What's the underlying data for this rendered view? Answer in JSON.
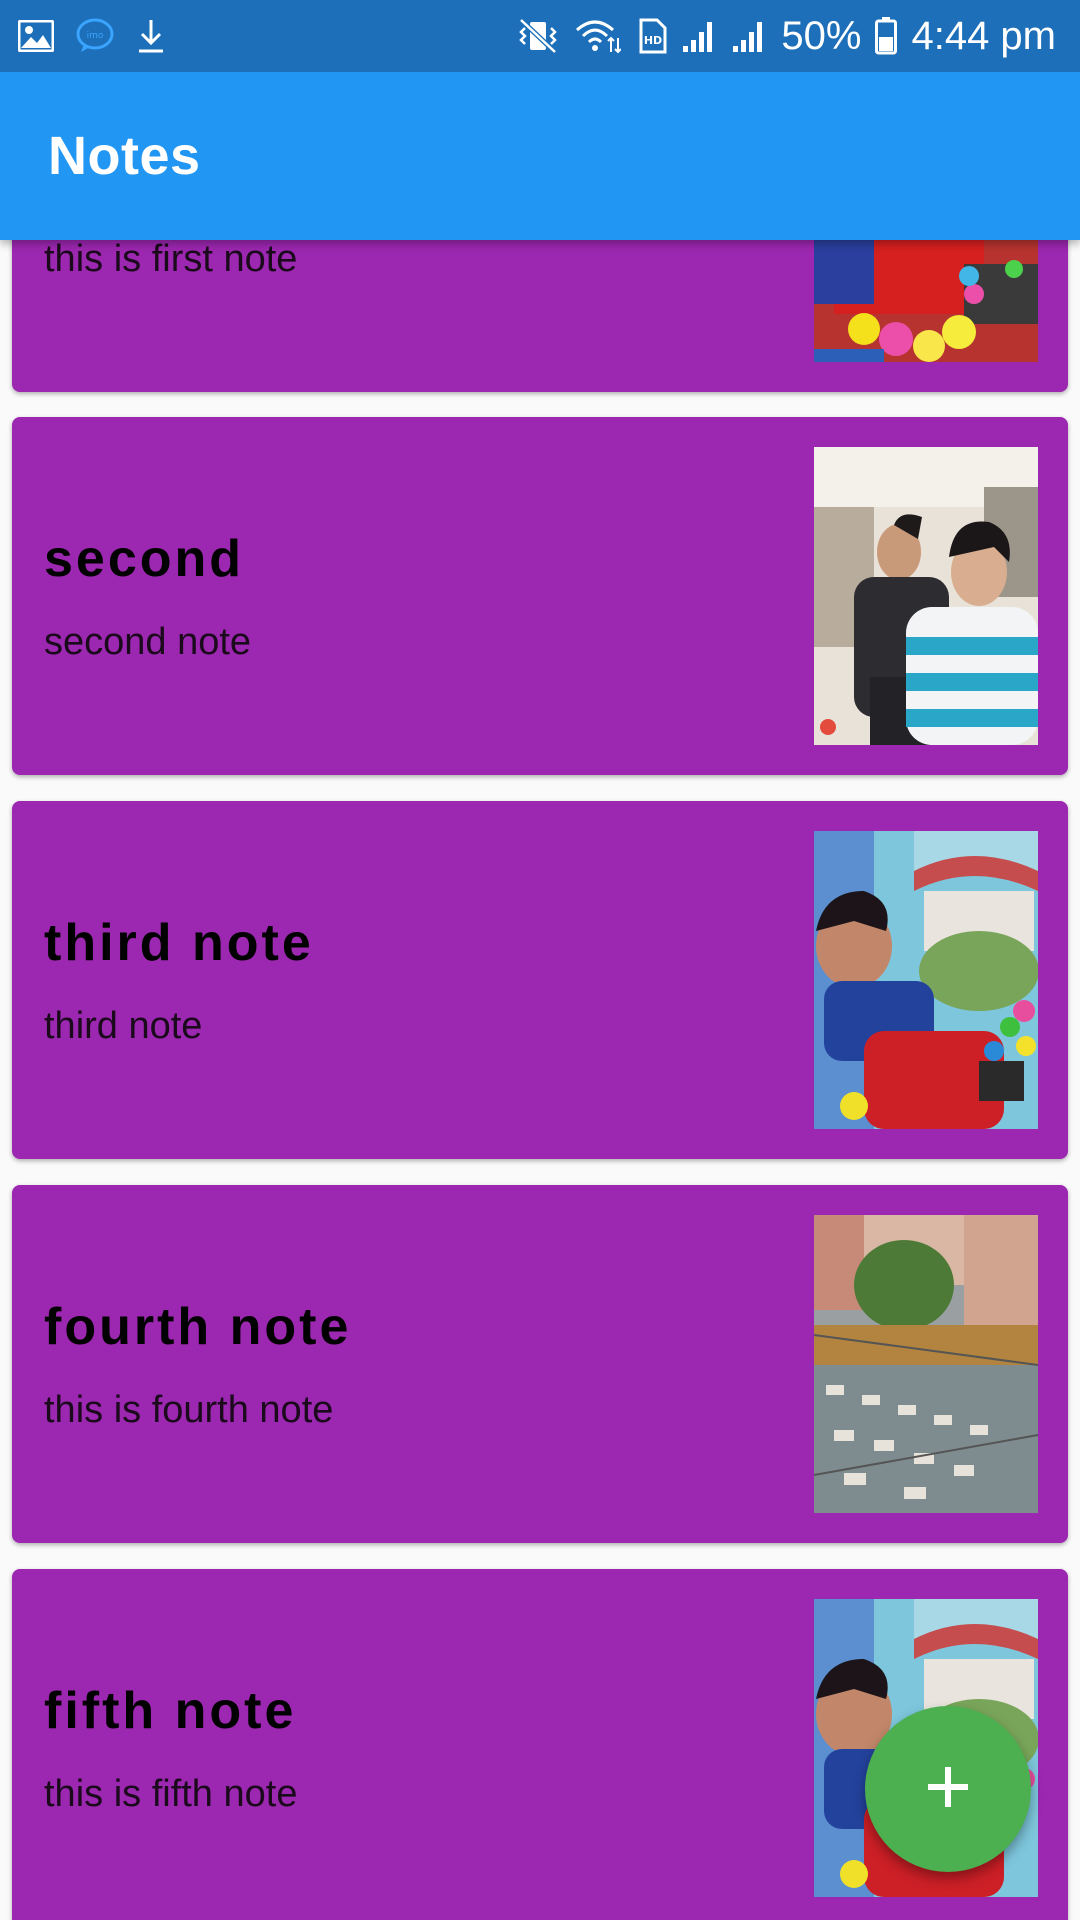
{
  "status_bar": {
    "left_icons": [
      "gallery-icon",
      "imo-icon",
      "download-icon"
    ],
    "right_icons": [
      "vibrate-icon",
      "wifi-icon",
      "hd-sim-icon",
      "signal-icon",
      "signal-icon",
      "battery-icon"
    ],
    "battery": "50%",
    "time": "4:44 pm"
  },
  "app_bar": {
    "title": "Notes"
  },
  "notes": [
    {
      "title": "",
      "body": "this is first note",
      "image": "kid-ball-pit-photo"
    },
    {
      "title": "second",
      "body": "second note",
      "image": "two-men-selfie-photo"
    },
    {
      "title": "third note",
      "body": "third note",
      "image": "child-play-area-photo"
    },
    {
      "title": "fourth note",
      "body": "this is fourth note",
      "image": "courtyard-tables-photo"
    },
    {
      "title": "fifth note",
      "body": "this is fifth note",
      "image": "child-play-area-photo"
    }
  ],
  "fab": {
    "icon": "plus-icon"
  },
  "colors": {
    "status_bar": "#1c6fb8",
    "app_bar": "#2196f3",
    "card": "#9c27b0",
    "fab": "#4caf50",
    "title_text": "#ffffff"
  }
}
